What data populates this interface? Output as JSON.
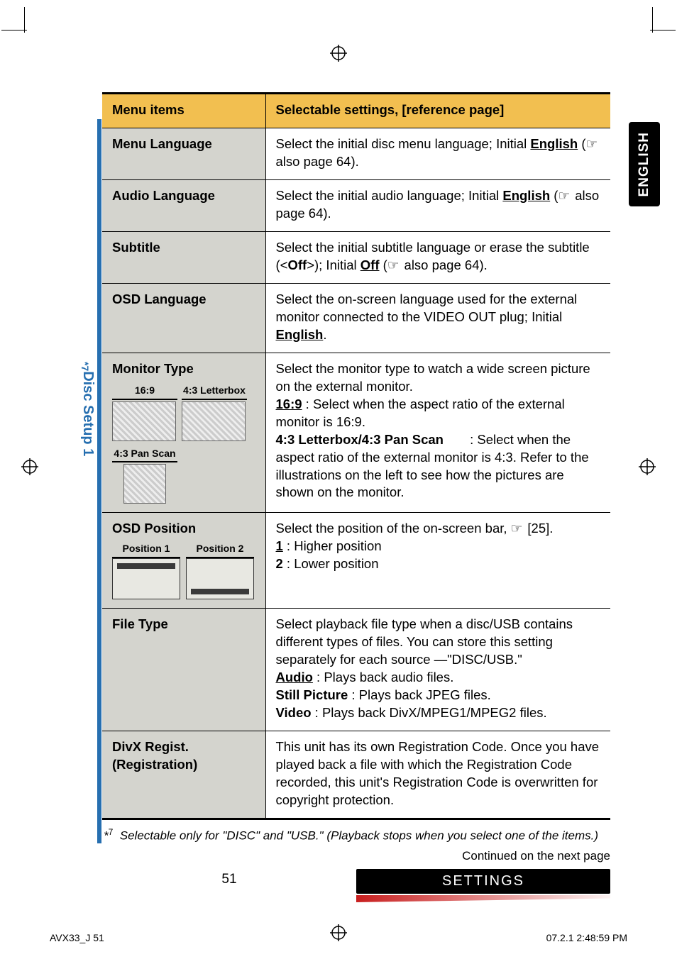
{
  "side_tab": "ENGLISH",
  "setup_label": "Disc Setup 1",
  "setup_label_star": "*7",
  "header": {
    "left": "Menu items",
    "right": "Selectable settings, [reference page]"
  },
  "rows": {
    "menu_language": {
      "title": "Menu Language",
      "text_a": "Select the initial disc menu language; Initial ",
      "link": "English",
      "text_b": " (",
      "text_c": " also page 64)."
    },
    "audio_language": {
      "title": "Audio Language",
      "text_a": "Select the initial audio language; Initial ",
      "link": "English",
      "text_b": " (",
      "text_c": " also page 64)."
    },
    "subtitle": {
      "title": "Subtitle",
      "text_a": "Select the initial subtitle language or erase the subtitle (<",
      "off_bold": "Off",
      "text_b": ">); Initial ",
      "off_link": "Off",
      "text_c": " (",
      "text_d": " also page 64)."
    },
    "osd_language": {
      "title": "OSD Language",
      "text_a": "Select the on-screen language used for the external monitor connected to the VIDEO OUT plug; Initial ",
      "link": "English",
      "text_b": "."
    },
    "monitor_type": {
      "title": "Monitor Type",
      "labels": {
        "a": "16:9",
        "b": "4:3 Letterbox",
        "c": "4:3 Pan Scan"
      },
      "line1": "Select the monitor type to watch a wide screen picture on the external monitor.",
      "opt1_label": "16:9",
      "opt1_text": " : Select when the aspect ratio of the external monitor is 16:9.",
      "opt2_label": "4:3 Letterbox/4:3 Pan Scan",
      "opt2_text": " : Select when the aspect ratio of the external monitor is 4:3. Refer to the illustrations on the left to see how the pictures are shown on the monitor."
    },
    "osd_position": {
      "title": "OSD Position",
      "labels": {
        "a": "Position 1",
        "b": "Position 2"
      },
      "line1_a": "Select the position of the on-screen bar, ",
      "line1_b": " [25].",
      "opt1_label": "1",
      "opt1_text": " : Higher position",
      "opt2_label": "2",
      "opt2_text": " : Lower position"
    },
    "file_type": {
      "title": "File Type",
      "line1": "Select playback file type when a disc/USB contains different types of files. You can store this setting separately for each source —\"DISC/USB.\"",
      "opt1_label": "Audio",
      "opt1_text": " : Plays back audio files.",
      "opt2_label": "Still Picture",
      "opt2_text": " : Plays back JPEG files.",
      "opt3_label": "Video",
      "opt3_text": " : Plays back DivX/MPEG1/MPEG2 files."
    },
    "divx": {
      "title": "DivX Regist. (Registration)",
      "text": "This unit has its own Registration Code. Once you have played back a file with which the Registration Code recorded, this unit's Registration Code is overwritten for copyright protection."
    }
  },
  "footnote_star": "*7",
  "footnote_text": "Selectable only for \"DISC\" and \"USB.\" (Playback stops when you select one of the items.)",
  "continued": "Continued on the next page",
  "page_number": "51",
  "settings_banner": "SETTINGS",
  "print_left": "AVX33_J   51",
  "print_right": "07.2.1   2:48:59 PM"
}
